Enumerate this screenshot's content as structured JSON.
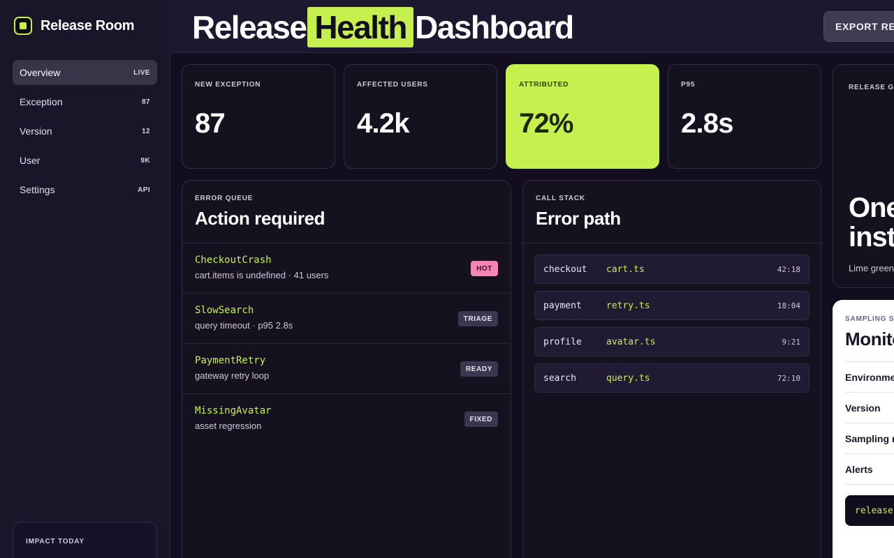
{
  "brand": {
    "name": "Release Room"
  },
  "sidebar": {
    "items": [
      {
        "label": "Overview",
        "badge": "LIVE"
      },
      {
        "label": "Exception",
        "badge": "87"
      },
      {
        "label": "Version",
        "badge": "12"
      },
      {
        "label": "User",
        "badge": "9K"
      },
      {
        "label": "Settings",
        "badge": "API"
      }
    ],
    "impact_label": "IMPACT TODAY"
  },
  "header": {
    "title_pre": "Release",
    "title_highlight": "Health",
    "title_post": "Dashboard",
    "export_label": "EXPORT REPORT"
  },
  "stats": [
    {
      "label": "NEW EXCEPTION",
      "value": "87"
    },
    {
      "label": "AFFECTED USERS",
      "value": "4.2k"
    },
    {
      "label": "ATTRIBUTED",
      "value": "72%"
    },
    {
      "label": "P95",
      "value": "2.8s"
    }
  ],
  "error_queue": {
    "eyebrow": "ERROR QUEUE",
    "title": "Action required",
    "rows": [
      {
        "name": "CheckoutCrash",
        "desc": "cart.items is undefined · 41 users",
        "tag": "HOT"
      },
      {
        "name": "SlowSearch",
        "desc": "query timeout · p95 2.8s",
        "tag": "TRIAGE"
      },
      {
        "name": "PaymentRetry",
        "desc": "gateway retry loop",
        "tag": "READY"
      },
      {
        "name": "MissingAvatar",
        "desc": "asset regression",
        "tag": "FIXED"
      }
    ]
  },
  "call_stack": {
    "eyebrow": "CALL STACK",
    "title": "Error path",
    "rows": [
      {
        "fn": "checkout",
        "file": "cart.ts",
        "line": "42:18"
      },
      {
        "fn": "payment",
        "file": "retry.ts",
        "line": "18:04"
      },
      {
        "fn": "profile",
        "file": "avatar.ts",
        "line": "9:21"
      },
      {
        "fn": "search",
        "file": "query.ts",
        "line": "72:10"
      }
    ]
  },
  "release_gate": {
    "eyebrow": "RELEASE GATE",
    "big_line1": "One",
    "big_line2": "inst",
    "subtitle": "Lime green"
  },
  "sampling": {
    "eyebrow": "SAMPLING STATUS",
    "title": "Monitor",
    "items": [
      "Environment",
      "Version",
      "Sampling rate",
      "Alerts"
    ],
    "code": "release.health"
  }
}
